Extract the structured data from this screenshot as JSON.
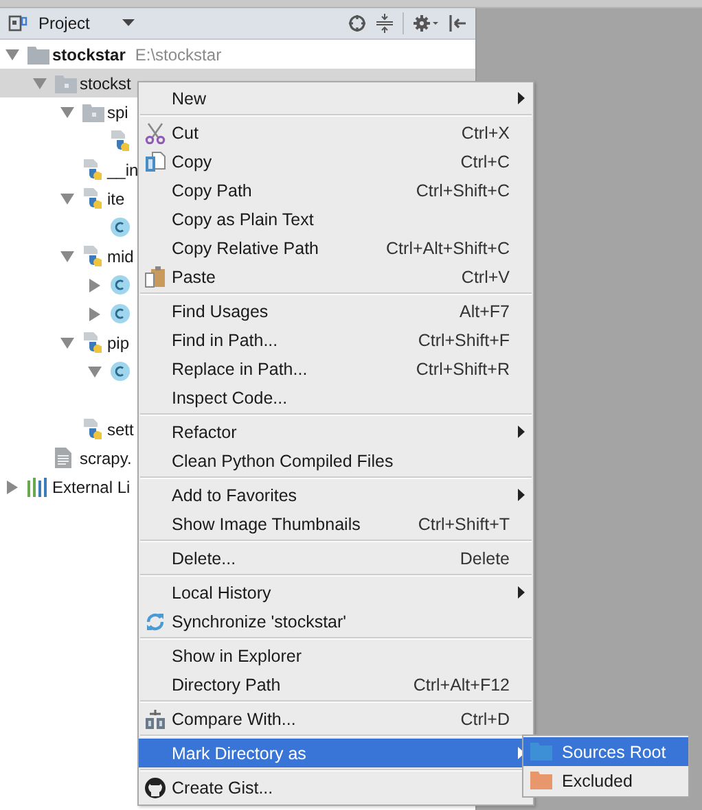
{
  "panel": {
    "title": "Project"
  },
  "tree": [
    {
      "kind": "folder",
      "label": "stockstar",
      "path": "E:\\stockstar",
      "bold": true,
      "expanded": true,
      "selected": false,
      "children": [
        {
          "kind": "package",
          "label": "stockst",
          "expanded": true,
          "selected": true,
          "children": [
            {
              "kind": "package",
              "label": "spi",
              "expanded": true,
              "selected": false,
              "children": [
                {
                  "kind": "python",
                  "selected": false
                }
              ]
            },
            {
              "kind": "python",
              "label": "__in",
              "selected": false
            },
            {
              "kind": "python",
              "label": "ite",
              "expanded": true,
              "selected": false,
              "children": [
                {
                  "kind": "class",
                  "selected": false
                }
              ]
            },
            {
              "kind": "python",
              "label": "mid",
              "expanded": true,
              "selected": false,
              "children": [
                {
                  "kind": "class",
                  "expanded": false,
                  "selected": false
                },
                {
                  "kind": "class",
                  "expanded": false,
                  "selected": false
                }
              ]
            },
            {
              "kind": "python",
              "label": "pip",
              "expanded": true,
              "selected": false,
              "children": [
                {
                  "kind": "class",
                  "expanded": true,
                  "selected": false,
                  "children": [
                    {
                      "selected": false
                    }
                  ]
                }
              ]
            },
            {
              "kind": "python",
              "label": "sett",
              "selected": false
            }
          ]
        },
        {
          "kind": "text",
          "label": "scrapy.",
          "selected": false
        }
      ]
    },
    {
      "kind": "library",
      "label": "External Li",
      "expanded": false,
      "selected": false
    }
  ],
  "menu": [
    [
      {
        "label": "New",
        "submenu": true,
        "selected": false
      }
    ],
    [
      {
        "kind": "cut",
        "label": "Cut",
        "shortcut": "Ctrl+X",
        "selected": false
      },
      {
        "kind": "copy",
        "label": "Copy",
        "shortcut": "Ctrl+C",
        "selected": false
      },
      {
        "label": "Copy Path",
        "shortcut": "Ctrl+Shift+C",
        "selected": false
      },
      {
        "label": "Copy as Plain Text",
        "selected": false
      },
      {
        "label": "Copy Relative Path",
        "shortcut": "Ctrl+Alt+Shift+C",
        "selected": false
      },
      {
        "kind": "paste",
        "label": "Paste",
        "shortcut": "Ctrl+V",
        "selected": false
      }
    ],
    [
      {
        "label": "Find Usages",
        "shortcut": "Alt+F7",
        "selected": false
      },
      {
        "label": "Find in Path...",
        "shortcut": "Ctrl+Shift+F",
        "selected": false
      },
      {
        "label": "Replace in Path...",
        "shortcut": "Ctrl+Shift+R",
        "selected": false
      },
      {
        "label": "Inspect Code...",
        "selected": false
      }
    ],
    [
      {
        "label": "Refactor",
        "submenu": true,
        "selected": false
      },
      {
        "label": "Clean Python Compiled Files",
        "selected": false
      }
    ],
    [
      {
        "label": "Add to Favorites",
        "submenu": true,
        "selected": false
      },
      {
        "label": "Show Image Thumbnails",
        "shortcut": "Ctrl+Shift+T",
        "selected": false
      }
    ],
    [
      {
        "label": "Delete...",
        "shortcut": "Delete",
        "selected": false
      }
    ],
    [
      {
        "label": "Local History",
        "submenu": true,
        "selected": false
      },
      {
        "kind": "sync",
        "label": "Synchronize 'stockstar'",
        "selected": false
      }
    ],
    [
      {
        "label": "Show in Explorer",
        "selected": false
      },
      {
        "label": "Directory Path",
        "shortcut": "Ctrl+Alt+F12",
        "selected": false
      }
    ],
    [
      {
        "kind": "compare",
        "label": "Compare With...",
        "shortcut": "Ctrl+D",
        "selected": false
      }
    ],
    [
      {
        "label": "Mark Directory as",
        "submenu": true,
        "selected": true
      }
    ],
    [
      {
        "kind": "github",
        "label": "Create Gist...",
        "selected": false
      }
    ]
  ],
  "submenu": [
    {
      "color": "#3d8fd6",
      "label": "Sources Root",
      "selected": true
    },
    {
      "color": "#e8966c",
      "label": "Excluded",
      "selected": false
    }
  ]
}
